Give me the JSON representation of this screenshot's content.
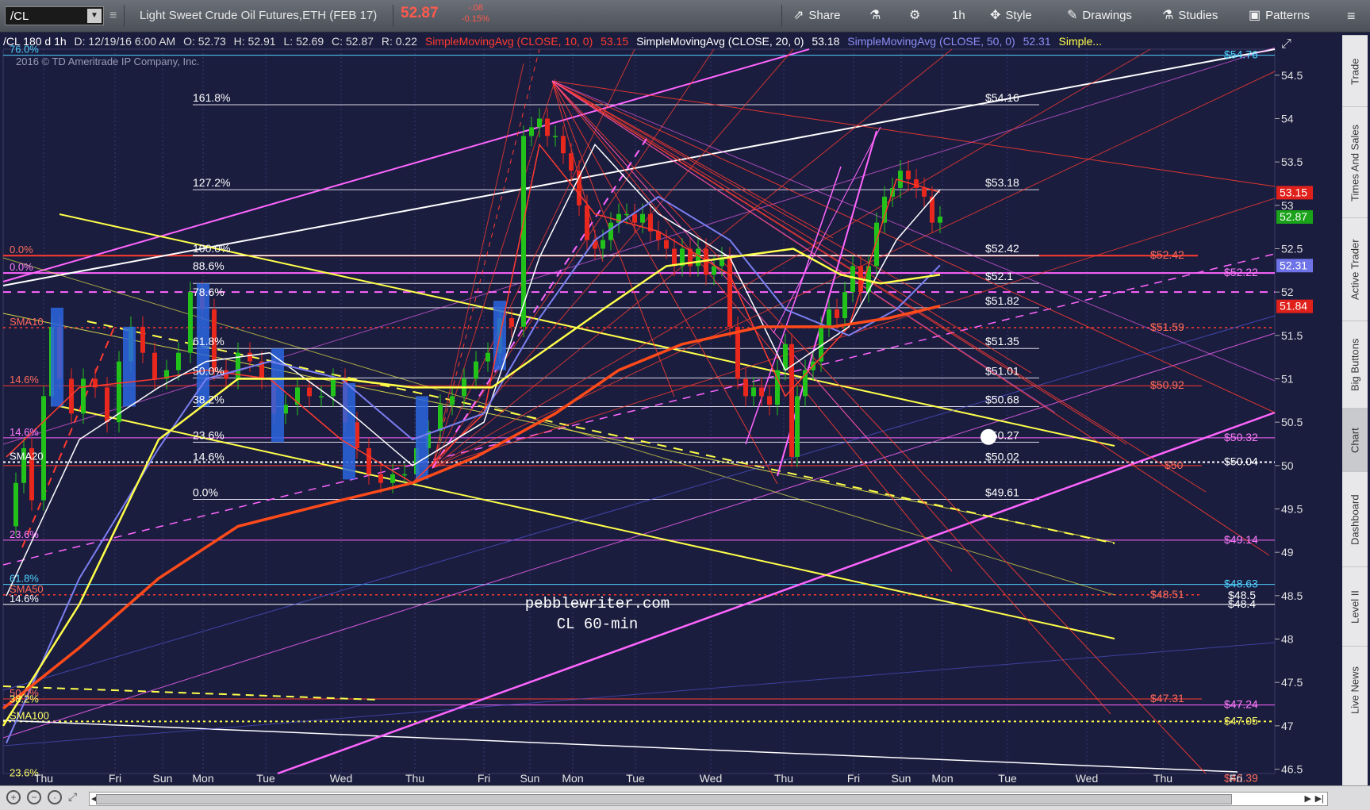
{
  "toolbar": {
    "symbol": "/CL",
    "title": "Light Sweet Crude Oil Futures,ETH (FEB 17)",
    "last": "52.87",
    "change": "-.08",
    "change_pct": "-0.15%",
    "share": "Share",
    "interval": "1h",
    "style": "Style",
    "drawings": "Drawings",
    "studies": "Studies",
    "patterns": "Patterns"
  },
  "legend": {
    "symbol_period": "/CL 180 d 1h",
    "date": "D: 12/19/16 6:00 AM",
    "open": "O: 52.73",
    "high": "H: 52.91",
    "low": "L: 52.69",
    "close": "C: 52.87",
    "range": "R: 0.22",
    "sma10": "SimpleMovingAvg (CLOSE, 10, 0)",
    "sma10_val": "53.15",
    "sma20": "SimpleMovingAvg (CLOSE, 20, 0)",
    "sma20_val": "53.18",
    "sma50": "SimpleMovingAvg (CLOSE, 50, 0)",
    "sma50_val": "52.31",
    "more": "Simple..."
  },
  "copyright": "2016 © TD Ameritrade IP Company, Inc.",
  "watermark": {
    "line1": "pebblewriter.com",
    "line2": "CL 60-min"
  },
  "fib_left": [
    "161.8%",
    "127.2%",
    "100.0%",
    "88.6%",
    "78.6%",
    "61.8%",
    "50.0%",
    "38.2%",
    "23.6%",
    "14.6%",
    "0.0%"
  ],
  "fib_right": [
    "$54.16",
    "$53.18",
    "$52.42",
    "$52.1",
    "$51.82",
    "$51.35",
    "$51.01",
    "$50.68",
    "$50.27",
    "$50.02",
    "$49.61"
  ],
  "left_labels": [
    {
      "text": "0.0%",
      "color": "#ff6b5b"
    },
    {
      "text": "0.0%",
      "color": "#ff7dff"
    },
    {
      "text": "SMA10",
      "color": "#ff6b5b"
    },
    {
      "text": "14.6%",
      "color": "#ff6b5b"
    },
    {
      "text": "14.6%",
      "color": "#ff7dff"
    },
    {
      "text": "SMA20",
      "color": "#ffffff"
    },
    {
      "text": "23.6%",
      "color": "#ff7dff"
    },
    {
      "text": "61.8%",
      "color": "#4fd2ff"
    },
    {
      "text": "SMA50",
      "color": "#ff6b5b"
    },
    {
      "text": "14.6%",
      "color": "#ffffff"
    },
    {
      "text": "50.0%",
      "color": "#ff6b5b"
    },
    {
      "text": "38.2%",
      "color": "#ffff66"
    },
    {
      "text": "SMA100",
      "color": "#ffff66"
    },
    {
      "text": "23.6%",
      "color": "#ffff66"
    },
    {
      "text": "76.0%",
      "color": "#4fd2ff"
    }
  ],
  "right_labels": [
    {
      "text": "$52.42",
      "color": "#ff6b5b"
    },
    {
      "text": "$52.22",
      "color": "#ff7dff"
    },
    {
      "text": "$51.59",
      "color": "#ff6b5b"
    },
    {
      "text": "$50.92",
      "color": "#ff6b5b"
    },
    {
      "text": "$50.32",
      "color": "#ff7dff"
    },
    {
      "text": "$50",
      "color": "#ff6b5b"
    },
    {
      "text": "$50.04",
      "color": "#ffffff"
    },
    {
      "text": "$49.14",
      "color": "#ff7dff"
    },
    {
      "text": "$48.63",
      "color": "#4fd2ff"
    },
    {
      "text": "$48.5",
      "color": "#ffffff"
    },
    {
      "text": "$48.51",
      "color": "#ff6b5b"
    },
    {
      "text": "$48.4",
      "color": "#ffffff"
    },
    {
      "text": "$47.31",
      "color": "#ff6b5b"
    },
    {
      "text": "$47.24",
      "color": "#ff7dff"
    },
    {
      "text": "$47.05",
      "color": "#ffff66"
    },
    {
      "text": "$46.39",
      "color": "#ff6b5b"
    },
    {
      "text": "$54.76",
      "color": "#4fd2ff"
    }
  ],
  "price_axis": [
    "54.5",
    "54",
    "53.5",
    "53",
    "52.5",
    "52",
    "51.5",
    "51",
    "50.5",
    "50",
    "49.5",
    "49",
    "48.5",
    "48",
    "47.5",
    "47",
    "46.5"
  ],
  "price_badges": [
    {
      "text": "53.15",
      "bg": "#e0201a"
    },
    {
      "text": "52.87",
      "bg": "#1aa31a"
    },
    {
      "text": "52.31",
      "bg": "#6f73e8"
    },
    {
      "text": "51.84",
      "bg": "#e0201a"
    }
  ],
  "x_axis": [
    "Thu",
    "Fri",
    "Sun",
    "Mon",
    "Tue",
    "Wed",
    "Thu",
    "Fri",
    "Sun",
    "Mon",
    "Tue",
    "Wed",
    "Thu",
    "Fri",
    "Sun",
    "Mon",
    "Tue",
    "Wed",
    "Thu",
    "Fri"
  ],
  "right_tabs": [
    "Trade",
    "Times And Sales",
    "Active Trader",
    "Big Buttons",
    "Chart",
    "Dashboard",
    "Level II",
    "Live News"
  ],
  "colors": {
    "background": "#1b1d3f",
    "sma10": "#ff3b2f",
    "sma20": "#ffffff",
    "sma50": "#7b7ff0",
    "sma100": "#ffff4a",
    "sma200": "#ff4a1a",
    "magenta": "#ff66ff",
    "candle_up": "#22c21a",
    "candle_down": "#e8271d"
  },
  "chart_data": {
    "type": "line",
    "title": "/CL 180 d 1h",
    "xlabel": "",
    "ylabel": "",
    "ylim": [
      46.5,
      54.8
    ],
    "x": [
      "Thu",
      "Fri",
      "Sun",
      "Mon",
      "Tue",
      "Wed",
      "Thu",
      "Fri",
      "Sun",
      "Mon",
      "Tue",
      "Wed",
      "Thu",
      "Fri",
      "Sun",
      "Mon"
    ],
    "series": [
      {
        "name": "SimpleMovingAvg (CLOSE, 10, 0)",
        "values": [
          50.1,
          50.9,
          51.0,
          51.1,
          51.0,
          50.3,
          49.8,
          50.6,
          53.7,
          52.9,
          52.7,
          52.2,
          50.8,
          51.6,
          53.3,
          53.15
        ]
      },
      {
        "name": "SimpleMovingAvg (CLOSE, 20, 0)",
        "values": [
          48.5,
          50.3,
          50.9,
          51.2,
          51.3,
          50.7,
          50.0,
          50.5,
          52.4,
          53.7,
          52.9,
          52.4,
          51.1,
          51.6,
          52.6,
          53.18
        ]
      },
      {
        "name": "SimpleMovingAvg (CLOSE, 50, 0)",
        "values": [
          46.8,
          48.7,
          50.2,
          51.0,
          51.2,
          51.0,
          50.3,
          50.6,
          51.7,
          52.6,
          53.1,
          52.6,
          51.8,
          51.5,
          51.8,
          52.31
        ]
      },
      {
        "name": "Close",
        "values": [
          49.8,
          51.2,
          50.8,
          51.4,
          50.9,
          49.9,
          49.7,
          51.2,
          53.9,
          52.6,
          52.9,
          52.4,
          50.7,
          52.0,
          53.4,
          52.87
        ]
      }
    ]
  }
}
